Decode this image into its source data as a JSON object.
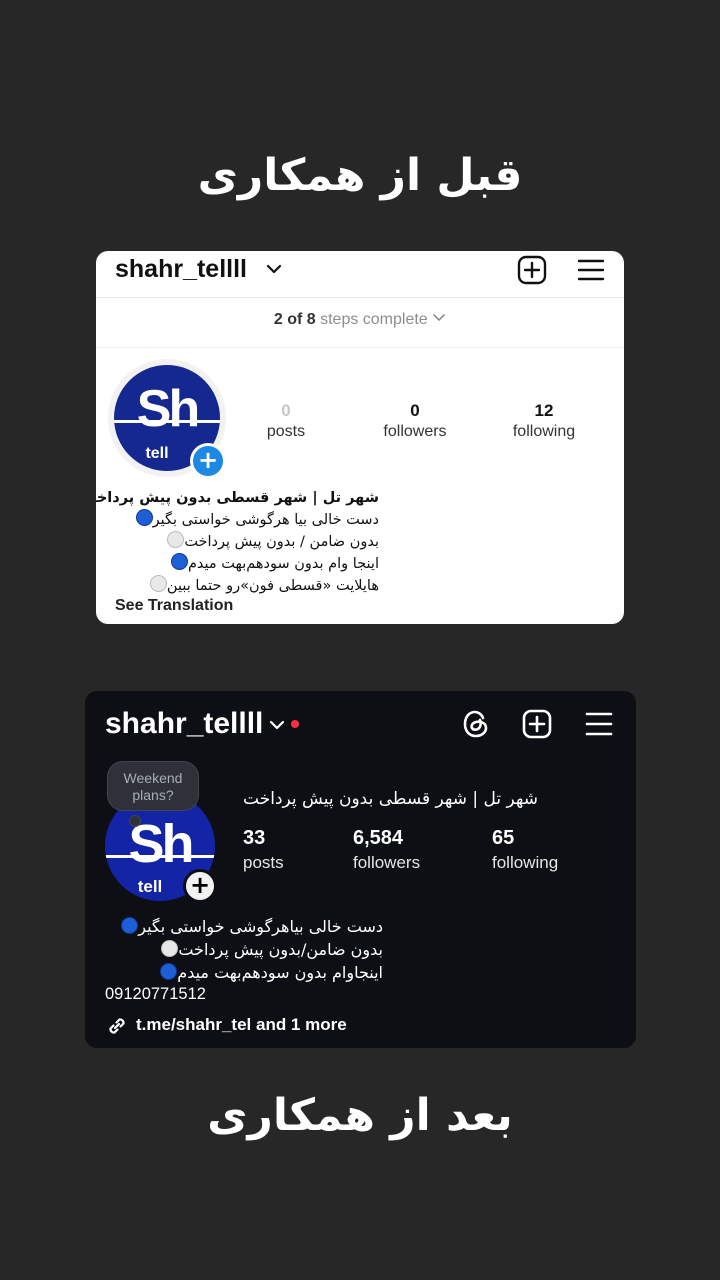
{
  "top_heading": "قبل از همکاری",
  "bottom_heading": "بعد از همکاری",
  "before": {
    "username": "shahr_tellll",
    "steps": {
      "done": "2 of 8",
      "rest": "steps complete"
    },
    "avatar": {
      "logo_main": "Sh",
      "logo_sub": "tell"
    },
    "stats": [
      {
        "value": "0",
        "label": "posts"
      },
      {
        "value": "0",
        "label": "followers"
      },
      {
        "value": "12",
        "label": "following"
      }
    ],
    "bio_name": "شهر تل | شهر قسطی بدون پیش پرداخت",
    "bio_lines": [
      {
        "dot": "blue",
        "text": "دست خالی بیا هرگوشی خواستی بگیر"
      },
      {
        "dot": "white",
        "text": "بدون ضامن / بدون پیش پرداخت"
      },
      {
        "dot": "blue",
        "text": "اینجا وام بدون سودهم‌بهت میدم"
      },
      {
        "dot": "white",
        "text": "هایلایت «قسطی فون»رو حتما ببین"
      }
    ],
    "see_translation": "See Translation"
  },
  "after": {
    "username": "shahr_tellll",
    "bubble": "Weekend plans?",
    "avatar": {
      "logo_main": "Sh",
      "logo_sub": "tell"
    },
    "name": "شهر تل | شهر قسطی بدون پیش پرداخت",
    "stats": [
      {
        "value": "33",
        "label": "posts"
      },
      {
        "value": "6,584",
        "label": "followers"
      },
      {
        "value": "65",
        "label": "following"
      }
    ],
    "bio_lines": [
      {
        "dot": "blue",
        "text": "دست خالی بیاهرگوشی خواستی بگیر"
      },
      {
        "dot": "white",
        "text": "بدون ضامن/بدون پیش پرداخت"
      },
      {
        "dot": "blue",
        "text": "اینجاوام بدون سودهم‌بهت میدم"
      }
    ],
    "phone": "09120771512",
    "link": "t.me/shahr_tel and 1 more"
  },
  "colors": {
    "brand_blue": "#15288f",
    "badge_blue": "#1e88e5",
    "notification_red": "#ff2d3f"
  }
}
